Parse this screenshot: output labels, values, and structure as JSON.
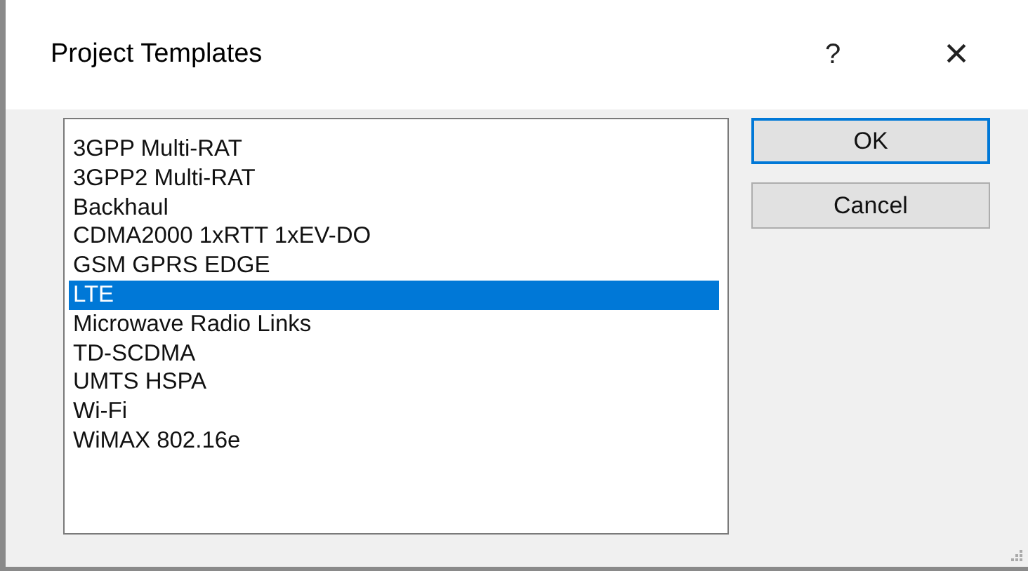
{
  "window": {
    "title": "Project Templates",
    "help": "?",
    "close": "×"
  },
  "templates": [
    {
      "label": "3GPP Multi-RAT",
      "selected": false
    },
    {
      "label": "3GPP2 Multi-RAT",
      "selected": false
    },
    {
      "label": "Backhaul",
      "selected": false
    },
    {
      "label": "CDMA2000 1xRTT 1xEV-DO",
      "selected": false
    },
    {
      "label": "GSM GPRS EDGE",
      "selected": false
    },
    {
      "label": "LTE",
      "selected": true
    },
    {
      "label": "Microwave Radio Links",
      "selected": false
    },
    {
      "label": "TD-SCDMA",
      "selected": false
    },
    {
      "label": "UMTS HSPA",
      "selected": false
    },
    {
      "label": "Wi-Fi",
      "selected": false
    },
    {
      "label": "WiMAX 802.16e",
      "selected": false
    }
  ],
  "buttons": [
    {
      "label": "OK",
      "default": true
    },
    {
      "label": "Cancel",
      "default": false
    }
  ]
}
